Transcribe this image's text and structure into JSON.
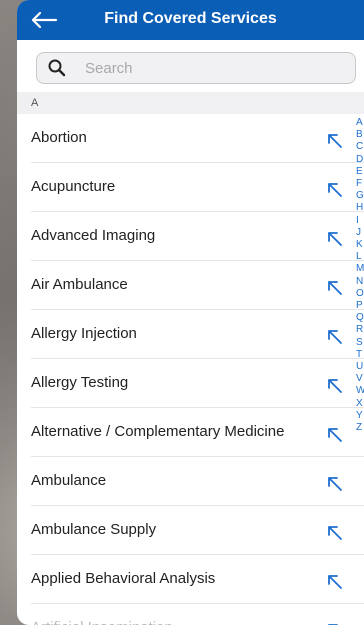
{
  "header": {
    "title": "Find Covered Services"
  },
  "search": {
    "placeholder": "Search",
    "value": ""
  },
  "section": {
    "letter": "A"
  },
  "items": [
    {
      "label": "Abortion"
    },
    {
      "label": "Acupuncture"
    },
    {
      "label": "Advanced Imaging"
    },
    {
      "label": "Air Ambulance"
    },
    {
      "label": "Allergy Injection"
    },
    {
      "label": "Allergy Testing"
    },
    {
      "label": "Alternative / Complementary Medicine"
    },
    {
      "label": "Ambulance"
    },
    {
      "label": "Ambulance Supply"
    },
    {
      "label": "Applied Behavioral Analysis"
    },
    {
      "label": "Artificial Insemination"
    }
  ],
  "index_letters": [
    "A",
    "B",
    "C",
    "D",
    "E",
    "F",
    "G",
    "H",
    "I",
    "J",
    "K",
    "L",
    "M",
    "N",
    "O",
    "P",
    "Q",
    "R",
    "S",
    "T",
    "U",
    "V",
    "W",
    "X",
    "Y",
    "Z"
  ],
  "colors": {
    "header_bg": "#0b5eb5",
    "accent": "#1f6fcf"
  },
  "icons": {
    "back": "arrow-left-icon",
    "search": "magnifier-icon",
    "row": "arrow-up-left-icon"
  }
}
